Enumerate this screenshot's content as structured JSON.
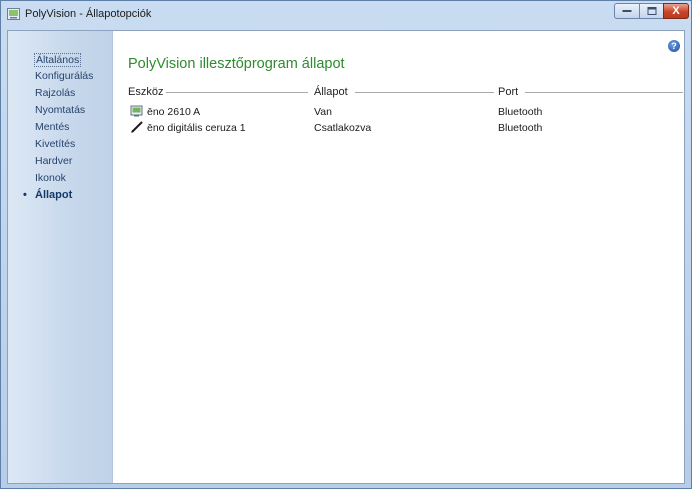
{
  "window": {
    "title": "PolyVision - Állapotopciók"
  },
  "controls": {
    "close_glyph": "X"
  },
  "sidebar": {
    "items": [
      {
        "label": "Általános"
      },
      {
        "label": "Konfigurálás"
      },
      {
        "label": "Rajzolás"
      },
      {
        "label": "Nyomtatás"
      },
      {
        "label": "Mentés"
      },
      {
        "label": "Kivetítés"
      },
      {
        "label": "Hardver"
      },
      {
        "label": "Ikonok"
      },
      {
        "label": "Állapot"
      }
    ],
    "active_bullet": "•"
  },
  "help": {
    "glyph": "?"
  },
  "main": {
    "title": "PolyVision illesztőprogram állapot",
    "columns": [
      "Eszköz",
      "Állapot",
      "Port"
    ],
    "rows": [
      {
        "icon": "printer-icon",
        "device": "ēno 2610 A",
        "status": "Van",
        "port": "Bluetooth"
      },
      {
        "icon": "pen-icon",
        "device": "ēno digitális ceruza 1",
        "status": "Csatlakozva",
        "port": "Bluetooth"
      }
    ]
  }
}
